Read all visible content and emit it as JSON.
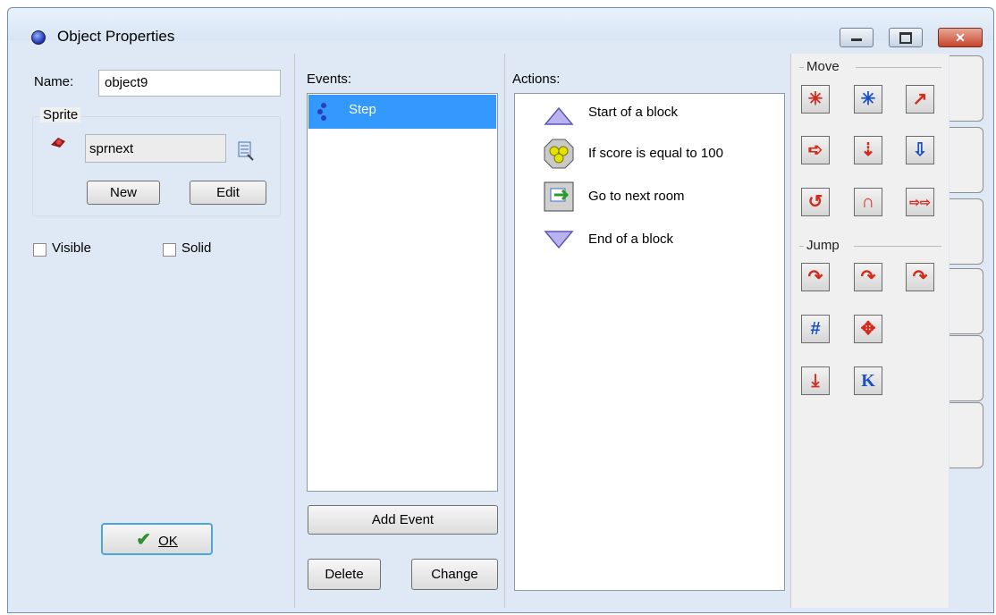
{
  "window": {
    "title": "Object Properties",
    "minimize_label": "▭",
    "maximize_label": "▢",
    "close_label": "✕"
  },
  "object": {
    "name_label": "Name:",
    "name_value": "object9",
    "sprite_group_label": "Sprite",
    "sprite_value": "sprnext",
    "new_button": "New",
    "edit_button": "Edit",
    "visible_label": "Visible",
    "visible_checked": false,
    "solid_label": "Solid",
    "solid_checked": false,
    "ok_button": "OK"
  },
  "events": {
    "header": "Events:",
    "items": [
      {
        "label": "Step",
        "selected": true,
        "icon": "step-icon"
      }
    ],
    "add_button": "Add Event",
    "delete_button": "Delete",
    "change_button": "Change"
  },
  "actions": {
    "header": "Actions:",
    "items": [
      {
        "label": "Start of a block",
        "icon": "start-block-icon"
      },
      {
        "label": "If score is equal to 100",
        "icon": "test-score-icon"
      },
      {
        "label": "Go to next room",
        "icon": "next-room-icon"
      },
      {
        "label": "End of a block",
        "icon": "end-block-icon"
      }
    ]
  },
  "palette": {
    "move_header": "Move",
    "jump_header": "Jump",
    "move_icons": [
      "move-fixed-icon",
      "move-free-icon",
      "move-towards-icon",
      "speed-horizontal-icon",
      "speed-vertical-icon",
      "gravity-icon",
      "reverse-horizontal-icon",
      "reverse-vertical-icon",
      "friction-icon"
    ],
    "jump_icons": [
      "jump-to-position-icon",
      "jump-to-start-icon",
      "jump-to-random-icon",
      "align-grid-icon",
      "wrap-screen-icon",
      "move-to-contact-icon",
      "bounce-icon"
    ]
  },
  "colors": {
    "selection": "#3399ff",
    "palette_icon_red": "#d42a1c",
    "palette_icon_blue": "#1c4fc4"
  }
}
